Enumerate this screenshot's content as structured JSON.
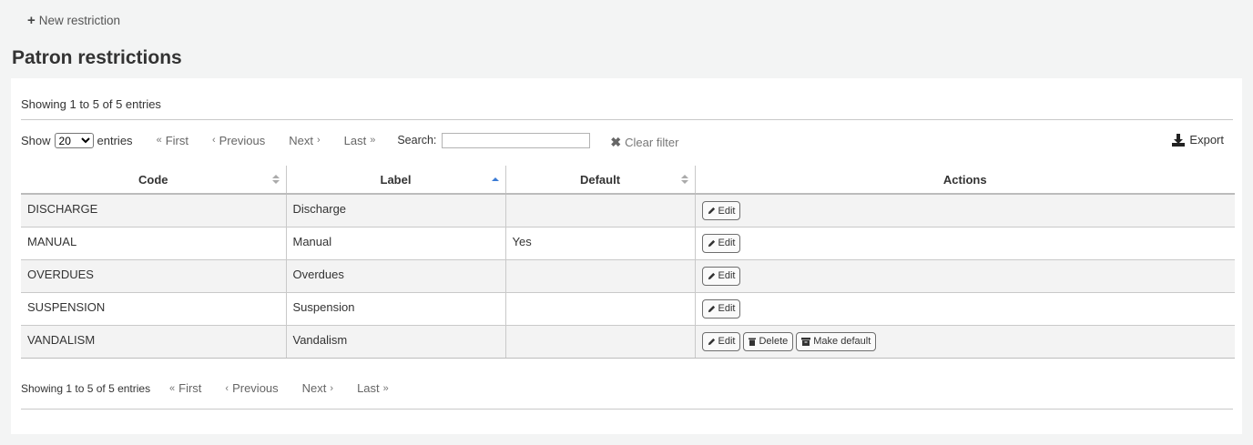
{
  "toolbar": {
    "new_restriction_label": "New restriction"
  },
  "page": {
    "title": "Patron restrictions"
  },
  "info": {
    "top": "Showing 1 to 5 of 5 entries",
    "bottom": "Showing 1 to 5 of 5 entries"
  },
  "controls": {
    "show_label": "Show",
    "entries_label": "entries",
    "page_size_options": [
      "10",
      "20",
      "50",
      "100"
    ],
    "page_size_selected": "20",
    "search_label": "Search:",
    "search_value": "",
    "clear_filter_label": "Clear filter",
    "export_label": "Export"
  },
  "pager": {
    "first": "First",
    "previous": "Previous",
    "next": "Next",
    "last": "Last"
  },
  "table": {
    "columns": [
      "Code",
      "Label",
      "Default",
      "Actions"
    ],
    "sorted_column": "Label",
    "rows": [
      {
        "code": "DISCHARGE",
        "label": "Discharge",
        "default": "",
        "actions": [
          "Edit"
        ]
      },
      {
        "code": "MANUAL",
        "label": "Manual",
        "default": "Yes",
        "actions": [
          "Edit"
        ]
      },
      {
        "code": "OVERDUES",
        "label": "Overdues",
        "default": "",
        "actions": [
          "Edit"
        ]
      },
      {
        "code": "SUSPENSION",
        "label": "Suspension",
        "default": "",
        "actions": [
          "Edit"
        ]
      },
      {
        "code": "VANDALISM",
        "label": "Vandalism",
        "default": "",
        "actions": [
          "Edit",
          "Delete",
          "Make default"
        ]
      }
    ]
  },
  "icons": {
    "new": "plus-icon",
    "clear": "x-icon",
    "export": "download-icon",
    "edit": "pencil-icon",
    "delete": "trash-icon",
    "make_default": "archive-icon"
  },
  "colors": {
    "sort_active": "#3a7bd5",
    "row_stripe": "#f3f3f3",
    "background": "#f3f4f4"
  }
}
